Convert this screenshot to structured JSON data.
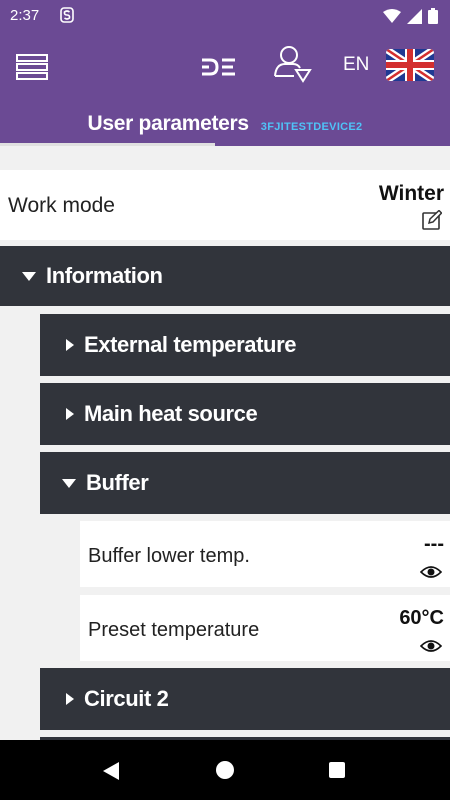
{
  "status_bar": {
    "time": "2:37",
    "app_icon": "s-icon",
    "icons": [
      "wifi-icon",
      "signal-icon",
      "battery-icon"
    ]
  },
  "header": {
    "menu_icon": "menu-icon",
    "logo_icon": "brand-logo-icon",
    "user_icon": "user-select-icon",
    "language": "EN",
    "flag": "uk-flag-icon",
    "title": "User parameters",
    "device": "3FJITESTDEVICE2"
  },
  "work_mode": {
    "label": "Work mode",
    "value": "Winter",
    "edit_icon": "edit-icon"
  },
  "sections": [
    {
      "label": "Information",
      "expanded": true
    },
    {
      "label": "External temperature",
      "expanded": false
    },
    {
      "label": "Main heat source",
      "expanded": false
    },
    {
      "label": "Buffer",
      "expanded": true
    },
    {
      "label": "Circuit 2",
      "expanded": false
    }
  ],
  "buffer_params": [
    {
      "label": "Buffer lower temp.",
      "value": "---",
      "icon": "eye-icon"
    },
    {
      "label": "Preset temperature",
      "value": "60°C",
      "icon": "eye-icon"
    }
  ],
  "colors": {
    "header": "#6b4a94",
    "section": "#31343b",
    "accent": "#4fc3f7",
    "background": "#f1f1f1"
  },
  "nav_bar": {
    "icons": [
      "back-icon",
      "home-icon",
      "recent-apps-icon"
    ]
  }
}
